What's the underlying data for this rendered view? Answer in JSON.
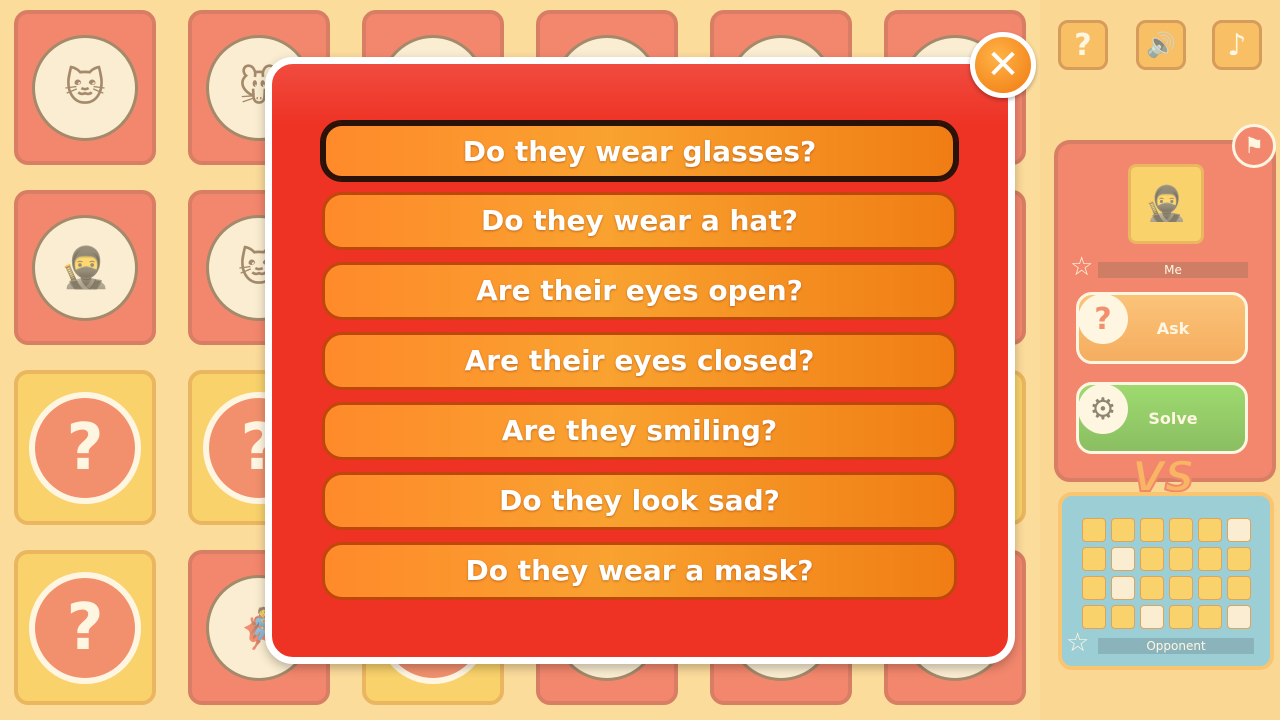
{
  "board": {
    "tiles": [
      {
        "kind": "face",
        "glyph": "🐱"
      },
      {
        "kind": "face",
        "glyph": "🐭"
      },
      {
        "kind": "face",
        "glyph": "🦁"
      },
      {
        "kind": "face",
        "glyph": "🐤"
      },
      {
        "kind": "face",
        "glyph": "🎭"
      },
      {
        "kind": "face",
        "glyph": "🐶"
      },
      {
        "kind": "face",
        "glyph": "🥷"
      },
      {
        "kind": "face",
        "glyph": "🐱"
      },
      {
        "kind": "face",
        "glyph": "🐱"
      },
      {
        "kind": "face",
        "glyph": "🐱"
      },
      {
        "kind": "face",
        "glyph": "🐱"
      },
      {
        "kind": "face",
        "glyph": "🐱"
      },
      {
        "kind": "hidden",
        "glyph": "?"
      },
      {
        "kind": "hidden",
        "glyph": "?"
      },
      {
        "kind": "hidden",
        "glyph": "?"
      },
      {
        "kind": "hidden",
        "glyph": "?"
      },
      {
        "kind": "hidden",
        "glyph": "?"
      },
      {
        "kind": "hidden",
        "glyph": "?"
      },
      {
        "kind": "hidden",
        "glyph": "?"
      },
      {
        "kind": "face",
        "glyph": "🦸"
      },
      {
        "kind": "hidden",
        "glyph": "?"
      },
      {
        "kind": "face",
        "glyph": "🐱"
      },
      {
        "kind": "face",
        "glyph": "🐱"
      },
      {
        "kind": "face",
        "glyph": "🐱"
      }
    ]
  },
  "toolbar": {
    "help_icon": "?",
    "sound_icon": "🔊",
    "music_icon": "♪"
  },
  "player": {
    "label": "Me",
    "avatar_glyph": "🥷",
    "flag_icon": "⚑",
    "star_icon": "☆"
  },
  "actions": {
    "ask_label": "Ask",
    "ask_icon": "?",
    "solve_label": "Solve",
    "solve_icon": "⚙"
  },
  "vs_label": "VS",
  "opponent": {
    "label": "Opponent",
    "star_icon": "☆",
    "board_faces_visible": [
      5,
      7,
      13,
      20,
      23
    ]
  },
  "dialog": {
    "close_icon": "✕",
    "selected_index": 0,
    "questions": [
      "Do they wear glasses?",
      "Do they wear a hat?",
      "Are their eyes open?",
      "Are their eyes closed?",
      "Are they smiling?",
      "Do they look sad?",
      "Do they wear a mask?"
    ]
  }
}
